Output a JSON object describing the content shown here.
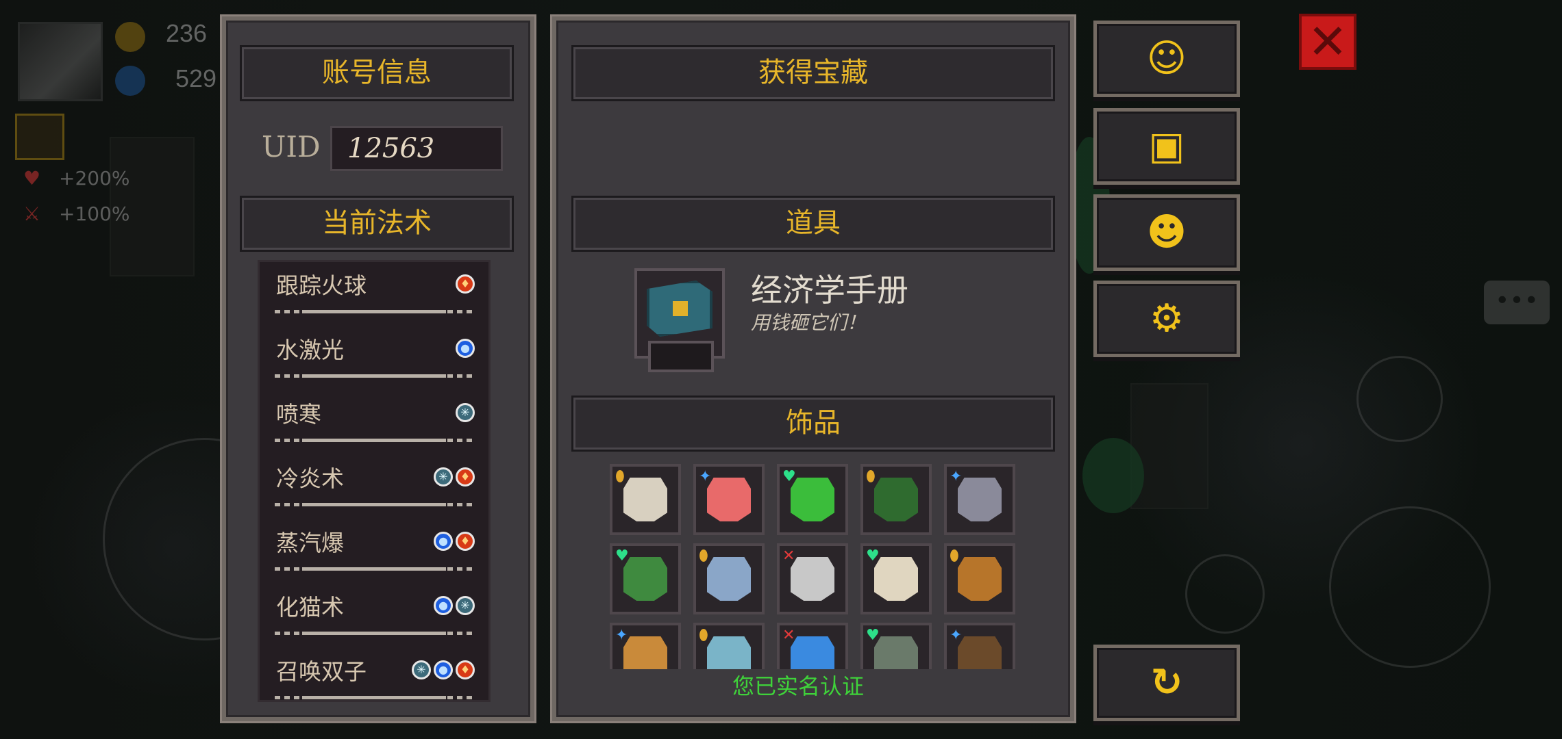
{
  "hud": {
    "gold": "236",
    "gems": "529",
    "buff_hp": "+200%",
    "buff_atk": "+100%"
  },
  "account_panel": {
    "title": "账号信息",
    "uid_label": "UID",
    "uid_value": "12563",
    "spells_title": "当前法术",
    "spells": [
      {
        "name": "跟踪火球",
        "elements": [
          "fire"
        ]
      },
      {
        "name": "水激光",
        "elements": [
          "water"
        ]
      },
      {
        "name": "喷寒",
        "elements": [
          "ice"
        ]
      },
      {
        "name": "冷炎术",
        "elements": [
          "ice",
          "fire"
        ]
      },
      {
        "name": "蒸汽爆",
        "elements": [
          "water",
          "fire"
        ]
      },
      {
        "name": "化猫术",
        "elements": [
          "water",
          "ice"
        ]
      },
      {
        "name": "召唤双子",
        "elements": [
          "ice",
          "water",
          "fire"
        ]
      }
    ]
  },
  "treasure_panel": {
    "title": "获得宝藏",
    "props_title": "道具",
    "item_name": "经济学手册",
    "item_desc": "用钱砸它们！",
    "accessories_title": "饰品",
    "accessories": [
      {
        "icon": "shield-icon",
        "tag": "gold",
        "color": "#d8d0c0"
      },
      {
        "icon": "meat-icon",
        "tag": "blue",
        "color": "#e86a6a"
      },
      {
        "icon": "green-creature-icon",
        "tag": "green",
        "color": "#3bbd3b"
      },
      {
        "icon": "ten-percent-card-icon",
        "tag": "gold",
        "color": "#2f6b2f"
      },
      {
        "icon": "skull-necklace-icon",
        "tag": "blue",
        "color": "#8a8a9a"
      },
      {
        "icon": "clover-icon",
        "tag": "green",
        "color": "#3f8a3f"
      },
      {
        "icon": "hood-icon",
        "tag": "gold",
        "color": "#8aa6c8"
      },
      {
        "icon": "stone-icon",
        "tag": "red",
        "color": "#c8c8c8"
      },
      {
        "icon": "bone-icon",
        "tag": "green",
        "color": "#e0d6c0"
      },
      {
        "icon": "pickaxe-icon",
        "tag": "gold",
        "color": "#b7752a"
      },
      {
        "icon": "pie-icon",
        "tag": "blue",
        "color": "#c98a3a"
      },
      {
        "icon": "sock-icon",
        "tag": "gold",
        "color": "#7ab4c8"
      },
      {
        "icon": "crystal-icon",
        "tag": "red",
        "color": "#3a8ae0"
      },
      {
        "icon": "gun-icon",
        "tag": "green",
        "color": "#6a7a6a"
      },
      {
        "icon": "box-icon",
        "tag": "blue",
        "color": "#6b4a2a"
      }
    ],
    "verify_text": "您已实名认证"
  },
  "right_buttons": [
    {
      "icon": "headset-icon"
    },
    {
      "icon": "gift-icon"
    },
    {
      "icon": "character-icon"
    },
    {
      "icon": "gear-icon"
    },
    {
      "icon": "refresh-icon"
    }
  ],
  "colors": {
    "accent_gold": "#e8b62a",
    "panel_bg": "#3d3a3e",
    "verify_green": "#3fd23a",
    "close_red": "#c91a1a"
  }
}
